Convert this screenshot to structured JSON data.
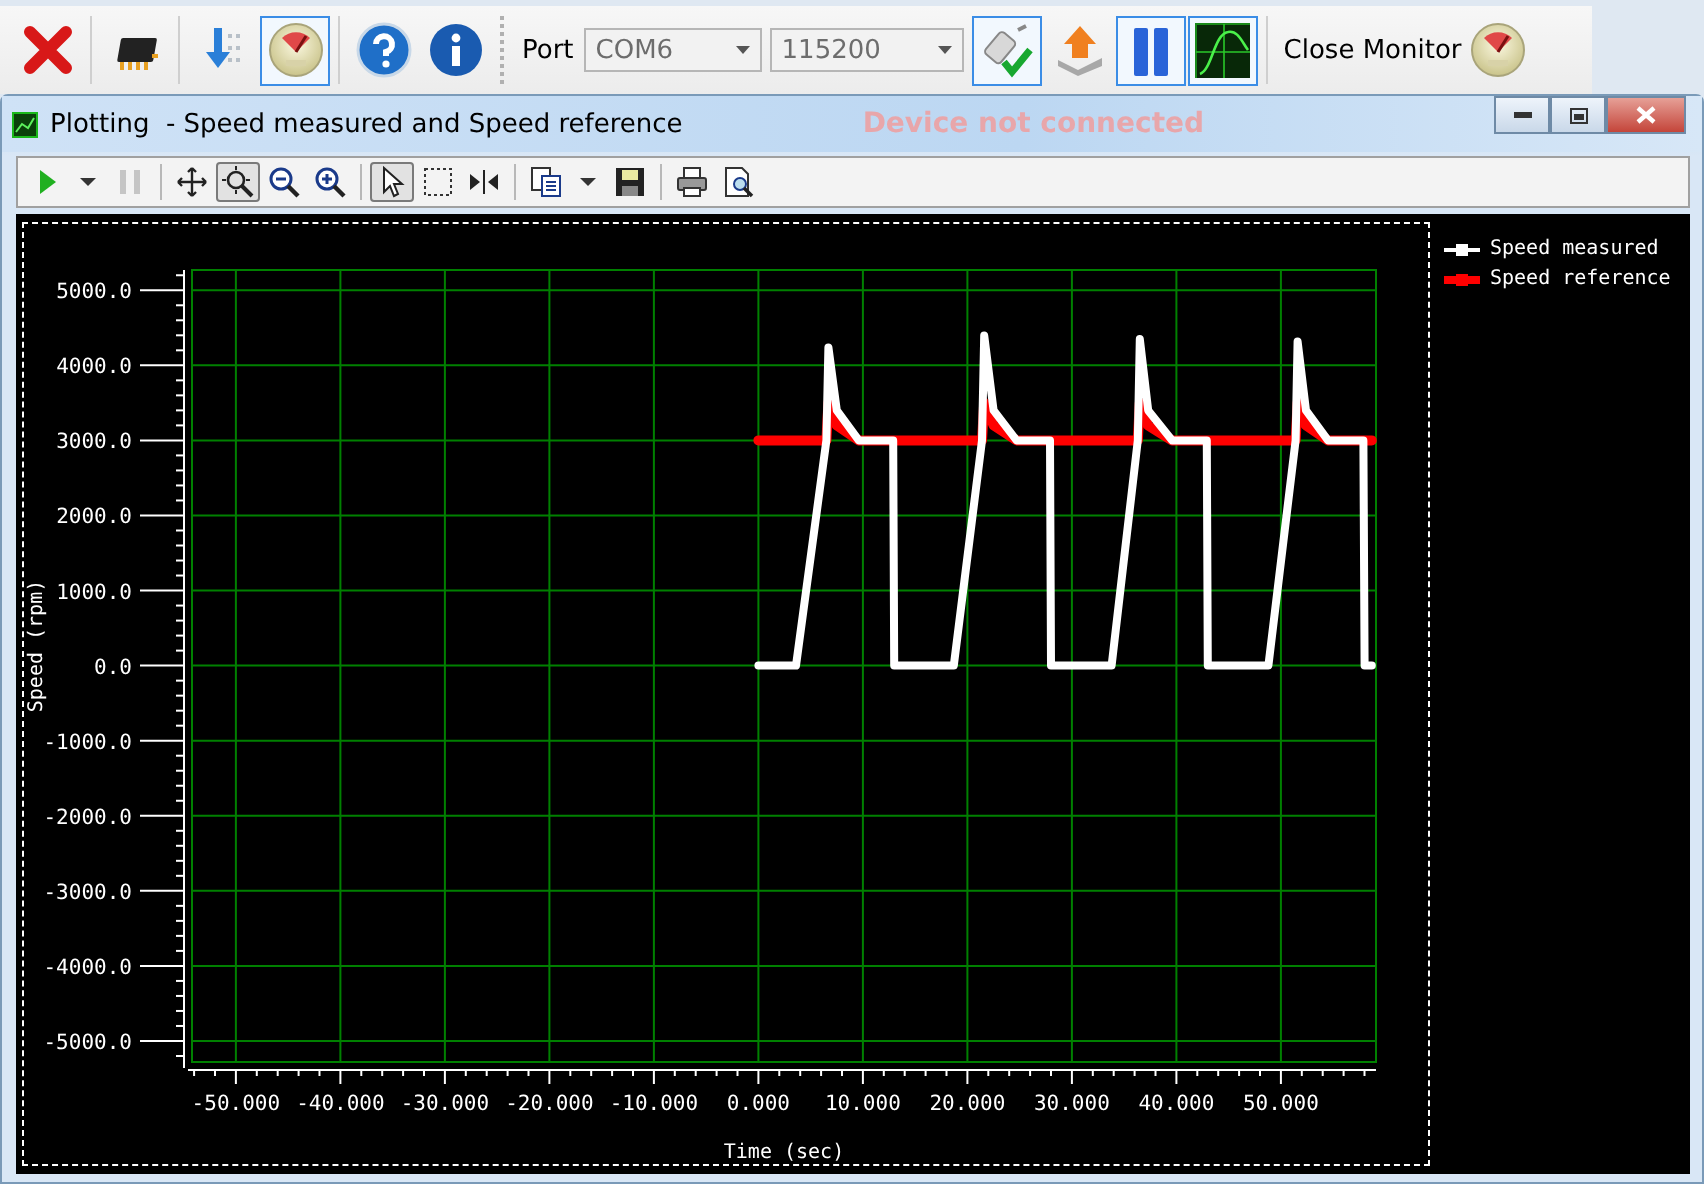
{
  "toolbar": {
    "buttons_left": [
      {
        "pressed": false
      },
      {
        "pressed": false
      },
      {
        "pressed": false
      },
      {
        "pressed": true
      },
      {
        "pressed": false
      },
      {
        "pressed": false
      }
    ],
    "port_label": "Port",
    "port": {
      "value": "COM6",
      "disabled": true
    },
    "baud": {
      "value": "115200",
      "disabled": true
    },
    "buttons_right": [
      {
        "pressed": true
      },
      {
        "pressed": false
      },
      {
        "pressed": true
      },
      {
        "pressed": true
      }
    ],
    "close_monitor": {
      "label": "Close Monitor"
    }
  },
  "window": {
    "title": "Plotting  - Speed measured and Speed reference",
    "connection_status": "Device not connected"
  },
  "plot_toolbar": [
    {
      "pressed": false,
      "disabled": false
    },
    {
      "pressed": false,
      "disabled": false
    },
    {
      "pressed": false,
      "disabled": true
    },
    {
      "pressed": false,
      "disabled": false
    },
    {
      "pressed": true,
      "disabled": false
    },
    {
      "pressed": false,
      "disabled": false
    },
    {
      "pressed": false,
      "disabled": false
    },
    {
      "pressed": true,
      "disabled": false
    },
    {
      "pressed": false,
      "disabled": false
    },
    {
      "pressed": false,
      "disabled": false
    },
    {
      "pressed": false,
      "disabled": false
    },
    {
      "pressed": false,
      "disabled": false
    },
    {
      "pressed": false,
      "disabled": false
    },
    {
      "pressed": false,
      "disabled": false
    },
    {
      "pressed": false,
      "disabled": false
    }
  ],
  "plot": {
    "chart_data": {
      "type": "line",
      "grid": true,
      "xlabel": "Time (sec)",
      "ylabel": "Speed (rpm)",
      "x": [
        0,
        3.6,
        6.5,
        6.7,
        7.5,
        9.6,
        12.9,
        13.0,
        18.7,
        21.4,
        21.6,
        22.5,
        24.7,
        27.9,
        28.0,
        33.8,
        36.3,
        36.5,
        37.3,
        39.6,
        42.9,
        43.0,
        48.8,
        51.4,
        51.6,
        52.4,
        54.5,
        57.9,
        58.0,
        58.7
      ],
      "series": [
        {
          "name": "Speed measured",
          "color": "#ffffff",
          "values": [
            0,
            0,
            3000,
            4240,
            3400,
            3000,
            3000,
            0,
            0,
            3000,
            4400,
            3400,
            3000,
            3000,
            0,
            0,
            3000,
            4350,
            3400,
            3000,
            3000,
            0,
            0,
            3000,
            4320,
            3400,
            3000,
            3000,
            0,
            0
          ]
        },
        {
          "name": "Speed reference",
          "color": "#ff0000",
          "values": [
            3000,
            3000,
            3000,
            3500,
            3200,
            3000,
            3000,
            3000,
            3000,
            3000,
            3500,
            3200,
            3000,
            3000,
            3000,
            3000,
            3000,
            3500,
            3200,
            3000,
            3000,
            3000,
            3000,
            3000,
            3500,
            3200,
            3000,
            3000,
            3000,
            3000
          ]
        }
      ],
      "xlim": [
        -54.2,
        59.1
      ],
      "ylim": [
        -5280,
        5270
      ],
      "xticks": [
        {
          "value": -50,
          "label": "-50.000"
        },
        {
          "value": -40,
          "label": "-40.000"
        },
        {
          "value": -30,
          "label": "-30.000"
        },
        {
          "value": -20,
          "label": "-20.000"
        },
        {
          "value": -10,
          "label": "-10.000"
        },
        {
          "value": 0,
          "label": "0.000"
        },
        {
          "value": 10,
          "label": "10.000"
        },
        {
          "value": 20,
          "label": "20.000"
        },
        {
          "value": 30,
          "label": "30.000"
        },
        {
          "value": 40,
          "label": "40.000"
        },
        {
          "value": 50,
          "label": "50.000"
        }
      ],
      "yticks": [
        {
          "value": 5000,
          "label": "5000.0"
        },
        {
          "value": 4000,
          "label": "4000.0"
        },
        {
          "value": 3000,
          "label": "3000.0"
        },
        {
          "value": 2000,
          "label": "2000.0"
        },
        {
          "value": 1000,
          "label": "1000.0"
        },
        {
          "value": 0,
          "label": "0.0"
        },
        {
          "value": -1000,
          "label": "-1000.0"
        },
        {
          "value": -2000,
          "label": "-2000.0"
        },
        {
          "value": -3000,
          "label": "-3000.0"
        },
        {
          "value": -4000,
          "label": "-4000.0"
        },
        {
          "value": -5000,
          "label": "-5000.0"
        }
      ]
    }
  }
}
